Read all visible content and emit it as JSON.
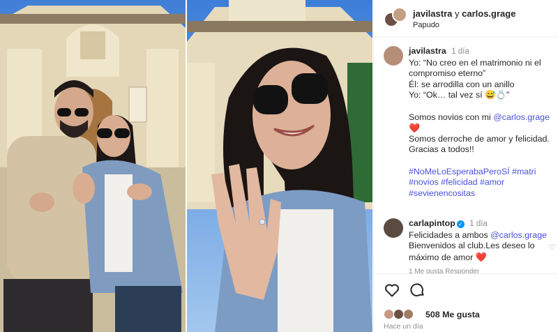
{
  "post": {
    "owners": {
      "user1": "javilastra",
      "joiner": "y",
      "user2": "carlos.grage"
    },
    "location": "Papudo"
  },
  "caption": {
    "username": "javilastra",
    "time": "1 día",
    "lines": [
      "Yo: “No creo en el matrimonio ni el",
      "compromiso eterno”",
      "Él: se arrodilla con un anillo",
      "Yo: “Ok… tal vez sí 😅💍”"
    ],
    "line_novios_prefix": "Somos novios con mi ",
    "line_novios_mention": "@carlos.grage",
    "heart": "❤️",
    "closing_lines": [
      "Somos derroche de amor y felicidad.",
      "Gracias a todos!!"
    ],
    "hashtags": [
      "#NoMeLoEsperabaPeroSÍ #matri",
      "#novios #felicidad #amor",
      "#sevienencositas"
    ]
  },
  "comment": {
    "username": "carlapintop",
    "verified_mark": "✓",
    "time": "1 día",
    "line1_prefix": "Felicidades a ambos ",
    "line1_mention": "@carlos.grage",
    "line2": "Bienvenidos al club.Les deseo lo",
    "line3_text": "máximo de amor ",
    "heart": "❤️",
    "meta": "1 Me gusta   Responder"
  },
  "actions": {
    "like_icon": "heart-outline-icon",
    "comment_icon": "speech-bubble-icon",
    "likes_count": "508 Me gusta",
    "posted_ago": "Hace un día"
  }
}
